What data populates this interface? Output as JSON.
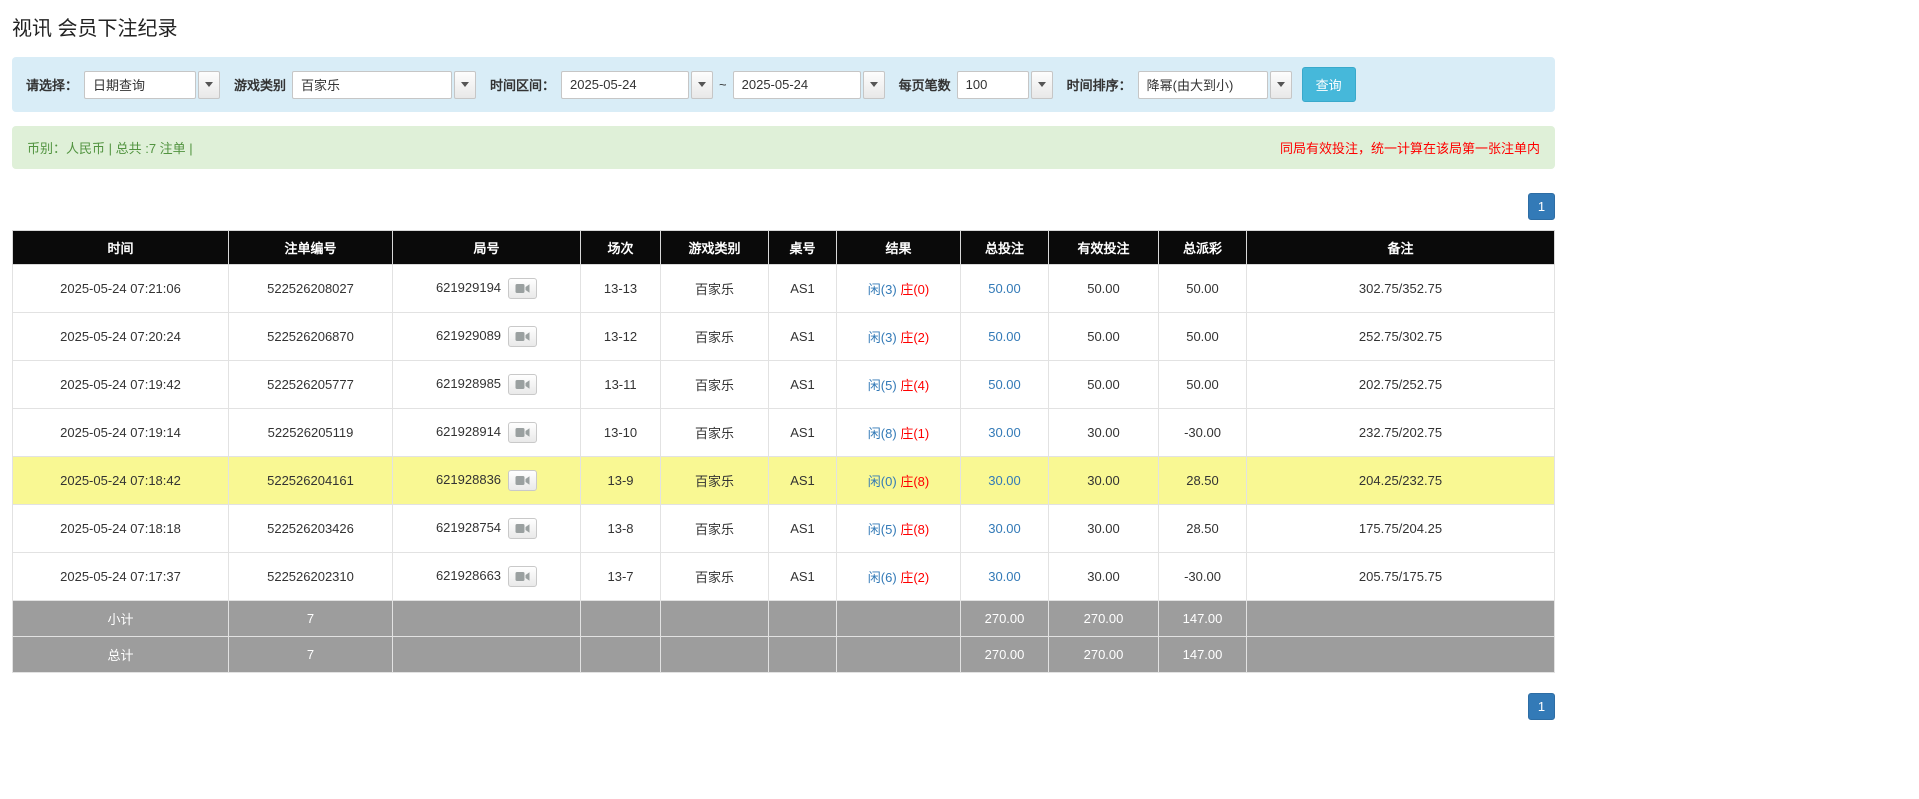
{
  "page": {
    "title": "视讯 会员下注纪录"
  },
  "filters": {
    "select_label": "请选择：",
    "select_value": "日期查询",
    "game_label": "游戏类别",
    "game_value": "百家乐",
    "range_label": "时间区间：",
    "date_from": "2025-05-24",
    "range_separator": "~",
    "date_to": "2025-05-24",
    "per_page_label": "每页笔数",
    "per_page_value": "100",
    "sort_label": "时间排序：",
    "sort_value": "降幂(由大到小)",
    "search_button": "查询"
  },
  "summary": {
    "left": "币别：人民币 | 总共 :7 注单 |",
    "right": "同局有效投注，统一计算在该局第一张注单内"
  },
  "pagination": {
    "page": "1"
  },
  "colors": {
    "filter_bg": "#d9edf7",
    "summary_bg": "#dff0d8",
    "summary_text_green": "#529440",
    "notice_red": "#ff0000",
    "header_bg": "#0a0a0a",
    "footer_bg": "#9d9d9d",
    "highlight_yellow": "#f9f893",
    "link_blue": "#337ab7",
    "player_blue": "#337ab7",
    "banker_red": "#ff0000",
    "search_button_bg": "#46b8da",
    "pager_blue": "#337ab7"
  },
  "table": {
    "headers": [
      "时间",
      "注单编号",
      "局号",
      "场次",
      "游戏类别",
      "桌号",
      "结果",
      "总投注",
      "有效投注",
      "总派彩",
      "备注"
    ],
    "rows": [
      {
        "time": "2025-05-24 07:21:06",
        "bet_id": "522526208027",
        "round_id": "621929194",
        "session": "13-13",
        "game": "百家乐",
        "table_no": "AS1",
        "result_player": "闲(3)",
        "result_banker": "庄(0)",
        "total_bet": "50.00",
        "valid_bet": "50.00",
        "payout": "50.00",
        "note": "302.75/352.75",
        "highlight": false
      },
      {
        "time": "2025-05-24 07:20:24",
        "bet_id": "522526206870",
        "round_id": "621929089",
        "session": "13-12",
        "game": "百家乐",
        "table_no": "AS1",
        "result_player": "闲(3)",
        "result_banker": "庄(2)",
        "total_bet": "50.00",
        "valid_bet": "50.00",
        "payout": "50.00",
        "note": "252.75/302.75",
        "highlight": false
      },
      {
        "time": "2025-05-24 07:19:42",
        "bet_id": "522526205777",
        "round_id": "621928985",
        "session": "13-11",
        "game": "百家乐",
        "table_no": "AS1",
        "result_player": "闲(5)",
        "result_banker": "庄(4)",
        "total_bet": "50.00",
        "valid_bet": "50.00",
        "payout": "50.00",
        "note": "202.75/252.75",
        "highlight": false
      },
      {
        "time": "2025-05-24 07:19:14",
        "bet_id": "522526205119",
        "round_id": "621928914",
        "session": "13-10",
        "game": "百家乐",
        "table_no": "AS1",
        "result_player": "闲(8)",
        "result_banker": "庄(1)",
        "total_bet": "30.00",
        "valid_bet": "30.00",
        "payout": "-30.00",
        "note": "232.75/202.75",
        "highlight": false
      },
      {
        "time": "2025-05-24 07:18:42",
        "bet_id": "522526204161",
        "round_id": "621928836",
        "session": "13-9",
        "game": "百家乐",
        "table_no": "AS1",
        "result_player": "闲(0)",
        "result_banker": "庄(8)",
        "total_bet": "30.00",
        "valid_bet": "30.00",
        "payout": "28.50",
        "note": "204.25/232.75",
        "highlight": true
      },
      {
        "time": "2025-05-24 07:18:18",
        "bet_id": "522526203426",
        "round_id": "621928754",
        "session": "13-8",
        "game": "百家乐",
        "table_no": "AS1",
        "result_player": "闲(5)",
        "result_banker": "庄(8)",
        "total_bet": "30.00",
        "valid_bet": "30.00",
        "payout": "28.50",
        "note": "175.75/204.25",
        "highlight": false
      },
      {
        "time": "2025-05-24 07:17:37",
        "bet_id": "522526202310",
        "round_id": "621928663",
        "session": "13-7",
        "game": "百家乐",
        "table_no": "AS1",
        "result_player": "闲(6)",
        "result_banker": "庄(2)",
        "total_bet": "30.00",
        "valid_bet": "30.00",
        "payout": "-30.00",
        "note": "205.75/175.75",
        "highlight": false
      }
    ],
    "subtotal": {
      "label": "小计",
      "count": "7",
      "total_bet": "270.00",
      "valid_bet": "270.00",
      "payout": "147.00"
    },
    "total": {
      "label": "总计",
      "count": "7",
      "total_bet": "270.00",
      "valid_bet": "270.00",
      "payout": "147.00"
    }
  }
}
